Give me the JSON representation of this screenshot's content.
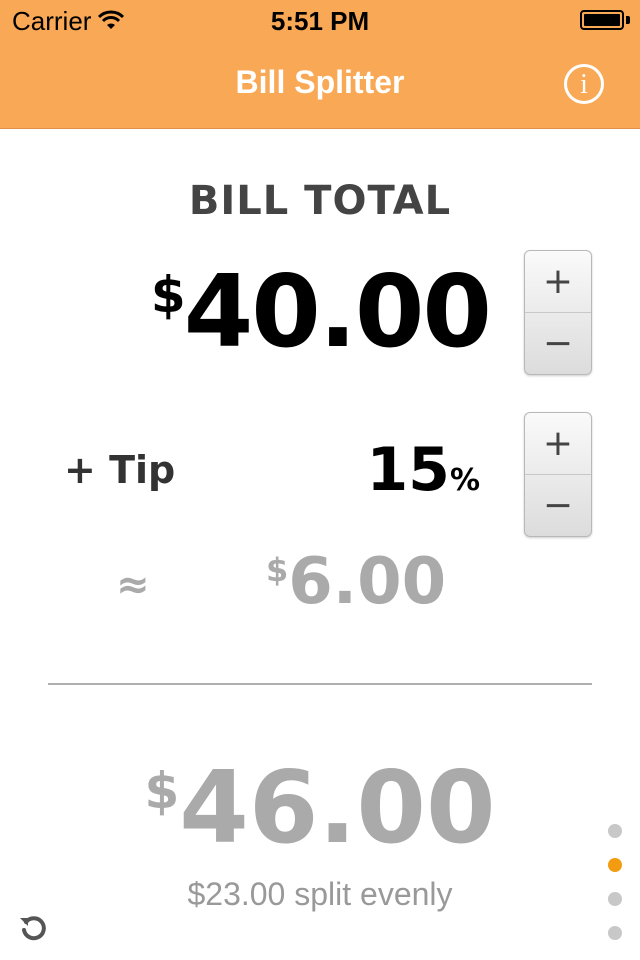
{
  "status_bar": {
    "carrier": "Carrier",
    "time": "5:51 PM"
  },
  "nav": {
    "title": "Bill Splitter",
    "info_icon": "info-icon"
  },
  "bill": {
    "label": "BILL TOTAL",
    "currency_symbol": "$",
    "amount": "40.00",
    "increment_label": "+",
    "decrement_label": "−"
  },
  "tip": {
    "label": "+ Tip",
    "percent": "15",
    "percent_symbol": "%",
    "approx_symbol": "≈",
    "currency_symbol": "$",
    "amount": "6.00",
    "increment_label": "+",
    "decrement_label": "−"
  },
  "total": {
    "currency_symbol": "$",
    "amount": "46.00",
    "split_text": "$23.00 split evenly"
  },
  "page_control": {
    "count": 4,
    "active_index": 1
  },
  "colors": {
    "accent": "#f9a856",
    "active_dot": "#f39c12"
  },
  "icons": {
    "refresh": "refresh-icon",
    "wifi": "wifi-icon",
    "battery": "battery-icon"
  }
}
